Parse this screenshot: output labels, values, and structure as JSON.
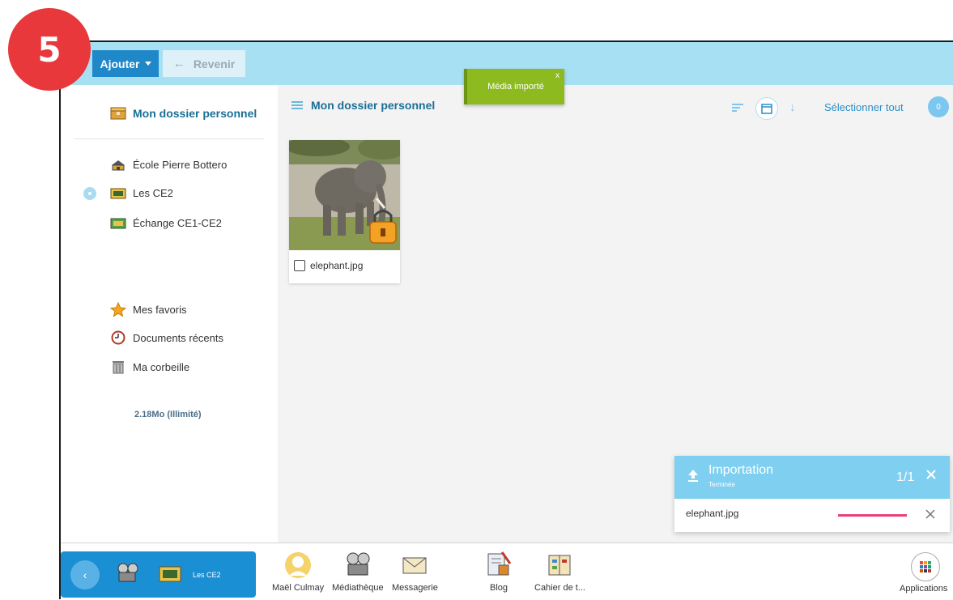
{
  "step_badge": "5",
  "toolbar": {
    "add_label": "Ajouter",
    "back_label": "Revenir"
  },
  "toast": {
    "message": "Média importé",
    "close": "x"
  },
  "sidebar": {
    "main_folder": "Mon dossier personnel",
    "groups": [
      {
        "label": "École Pierre Bottero",
        "icon": "school-icon"
      },
      {
        "label": "Les CE2",
        "icon": "class-board-icon"
      },
      {
        "label": "Échange CE1-CE2",
        "icon": "exchange-board-icon"
      }
    ],
    "shortcuts": [
      {
        "label": "Mes favoris",
        "icon": "star-icon"
      },
      {
        "label": "Documents récents",
        "icon": "clock-icon"
      },
      {
        "label": "Ma corbeille",
        "icon": "trash-icon"
      }
    ],
    "quota": "2.18Mo (Illimité)"
  },
  "content": {
    "title": "Mon dossier personnel",
    "select_all": "Sélectionner tout",
    "selected_count": "0",
    "files": [
      {
        "name": "elephant.jpg",
        "icon": "elephant-thumbnail"
      }
    ]
  },
  "import_panel": {
    "title": "Importation",
    "status": "Terminée",
    "count": "1/1",
    "file": "elephant.jpg",
    "progress": 1.0,
    "progress_color": "#e8407a"
  },
  "dock": {
    "pinned_label": "Les CE2",
    "apps": [
      {
        "label": "Maël Culmay",
        "icon": "avatar-icon"
      },
      {
        "label": "Médiathèque",
        "icon": "film-projector-icon"
      },
      {
        "label": "Messagerie",
        "icon": "envelope-icon"
      },
      {
        "label": "Blog",
        "icon": "blog-icon"
      },
      {
        "label": "Cahier de t...",
        "icon": "notebook-icon"
      }
    ],
    "applications_label": "Applications"
  },
  "colors": {
    "topbar": "#a7e0f3",
    "primary": "#1e88c9",
    "toast": "#8dba1e",
    "badge": "#e8383b"
  }
}
